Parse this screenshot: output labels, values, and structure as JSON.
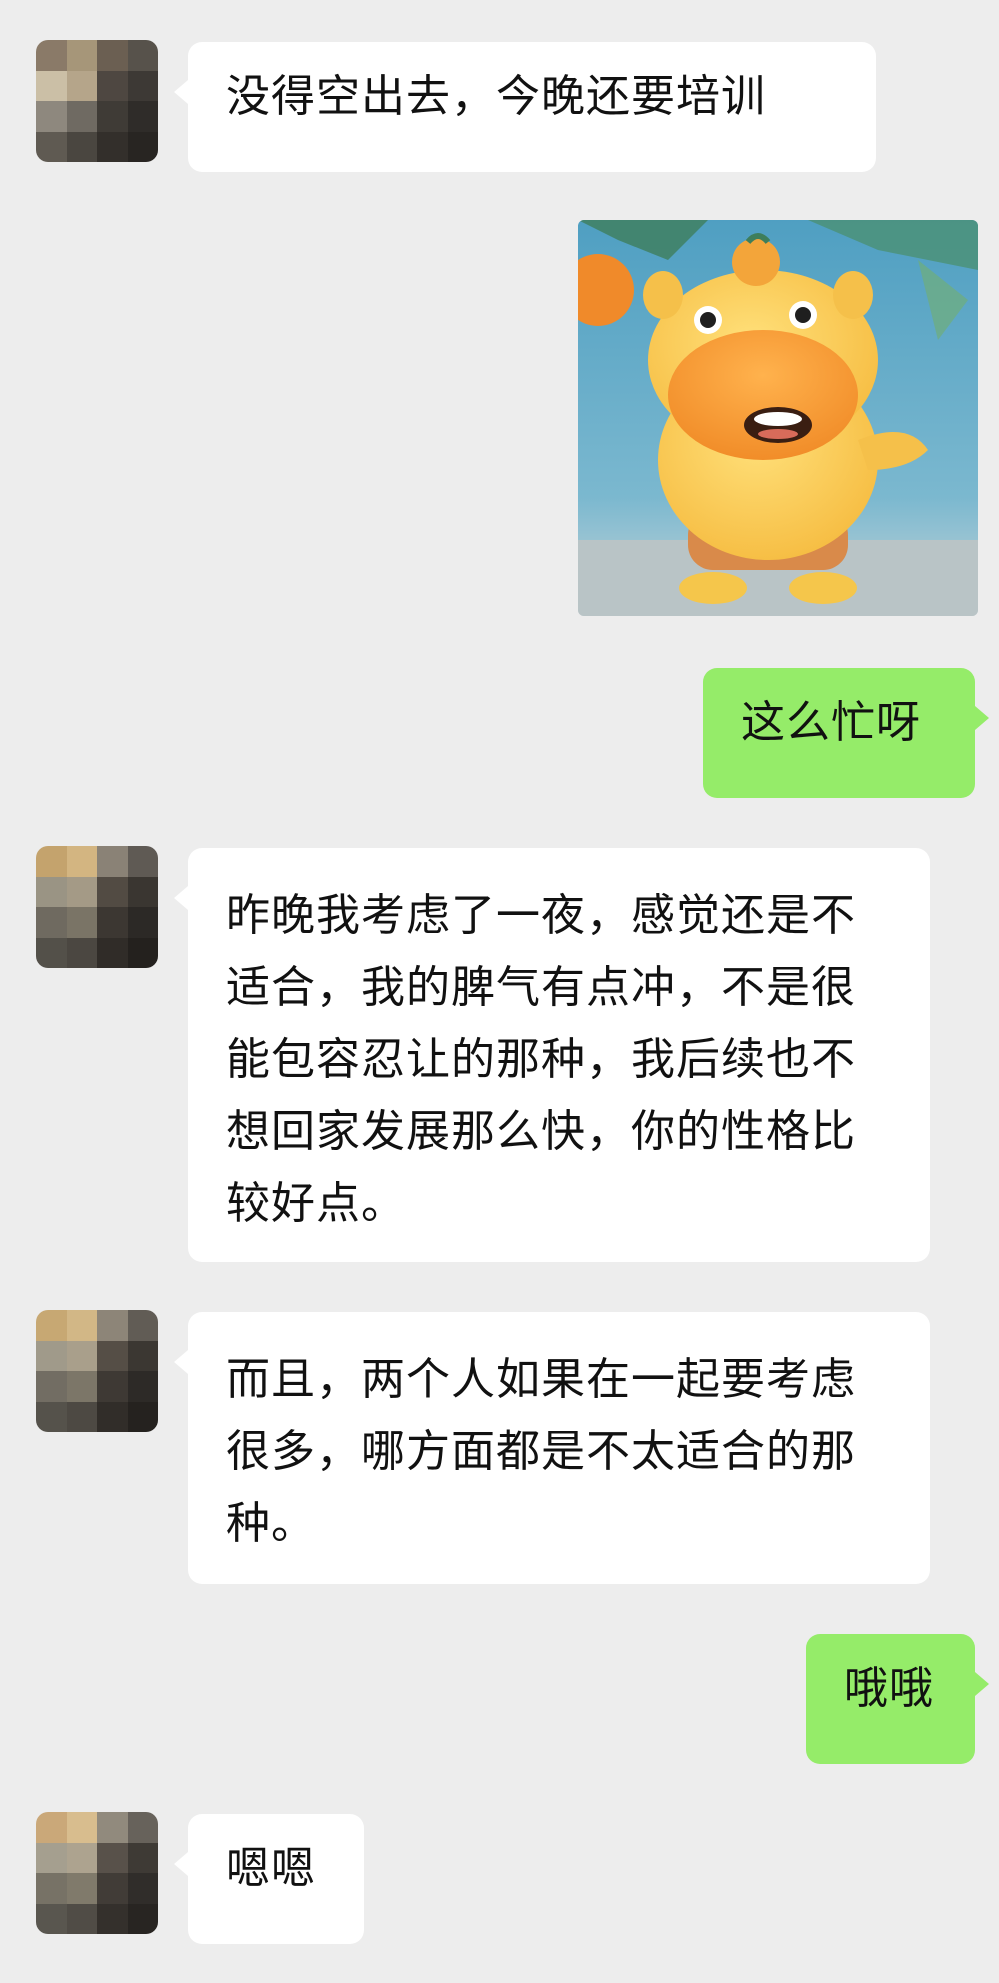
{
  "messages": {
    "m1": "没得空出去，今晚还要培训",
    "m3": "这么忙呀",
    "m4": "昨晚我考虑了一夜，感觉还是不适合，我的脾气有点冲，不是很能包容忍让的那种，我后续也不想回家发展那么快，你的性格比较好点。",
    "m5": "而且，两个人如果在一起要考虑很多，哪方面都是不太适合的那种。",
    "m6": "哦哦",
    "m7": "嗯嗯"
  },
  "colors": {
    "background": "#ededed",
    "incoming_bubble": "#ffffff",
    "outgoing_bubble": "#95ec69"
  },
  "icons": {
    "avatar": "pixelated-avatar",
    "sticker": "cartoon-hippo-sticker"
  }
}
